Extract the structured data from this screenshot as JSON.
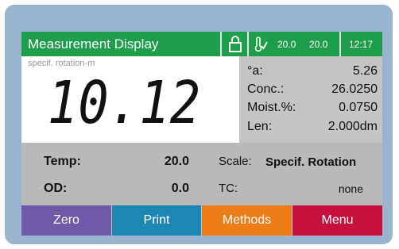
{
  "header": {
    "title": "Measurement Display",
    "temp_reading_1": "20.0",
    "temp_reading_2": "20.0",
    "time": "12:17"
  },
  "main": {
    "mode_label": "specif. rotation-m",
    "reading": "10.12"
  },
  "params": [
    {
      "label": "°a:",
      "value": "5.26"
    },
    {
      "label": "Conc.:",
      "value": "26.0250"
    },
    {
      "label": "Moist.%:",
      "value": "0.0750"
    },
    {
      "label": "Len:",
      "value": "2.000dm"
    }
  ],
  "info": {
    "temp_label": "Temp:",
    "temp_value": "20.0",
    "od_label": "OD:",
    "od_value": "0.0",
    "scale_label": "Scale:",
    "scale_value": "Specif. Rotation",
    "tc_label": "TC:",
    "tc_value": "none"
  },
  "buttons": {
    "zero": "Zero",
    "print": "Print",
    "methods": "Methods",
    "menu": "Menu"
  },
  "colors": {
    "title_bar": "#1e9d4a",
    "zero": "#6e5aa8",
    "print": "#1e86b3",
    "methods": "#ef7d17",
    "menu": "#c8103e",
    "frame": "#9ab4cf"
  },
  "icons": [
    "lock-icon",
    "thermometer-check-icon"
  ]
}
